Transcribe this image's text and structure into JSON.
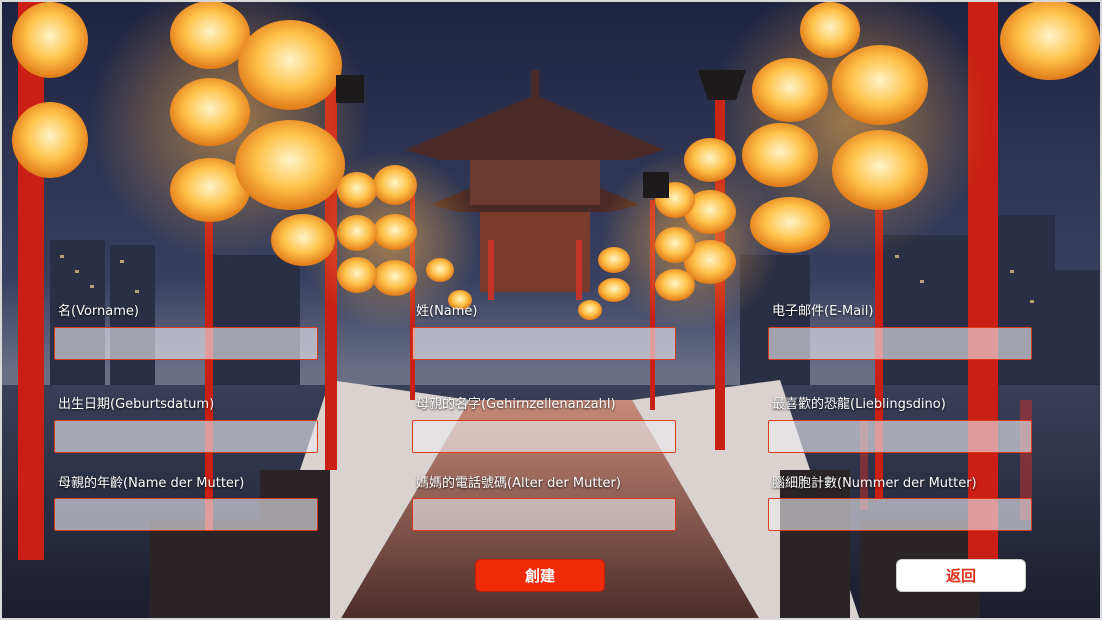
{
  "form": {
    "fields": [
      {
        "label": "名(Vorname)",
        "value": "",
        "placeholder": ""
      },
      {
        "label": "姓(Name)",
        "value": "",
        "placeholder": ""
      },
      {
        "label": "电子邮件(E-Mail)",
        "value": "",
        "placeholder": ""
      },
      {
        "label": "出生日期(Geburtsdatum)",
        "value": "",
        "placeholder": ""
      },
      {
        "label": "母親的名字(Gehirnzellenanzahl)",
        "value": "",
        "placeholder": ""
      },
      {
        "label": "最喜歡的恐龍(Lieblingsdino)",
        "value": "",
        "placeholder": ""
      },
      {
        "label": "母親的年齡(Name der Mutter)",
        "value": "",
        "placeholder": ""
      },
      {
        "label": "媽媽的電話號碼(Alter der Mutter)",
        "value": "",
        "placeholder": ""
      },
      {
        "label": "腦細胞計數(Nummer der Mutter)",
        "value": "",
        "placeholder": ""
      }
    ]
  },
  "buttons": {
    "create_label": "創建",
    "back_label": "返回"
  },
  "colors": {
    "accent": "#f12b09",
    "input_border": "#e03a1e",
    "back_text": "#e0301a"
  },
  "background": {
    "scene": "night-lantern-pavilion-pier-photo"
  }
}
